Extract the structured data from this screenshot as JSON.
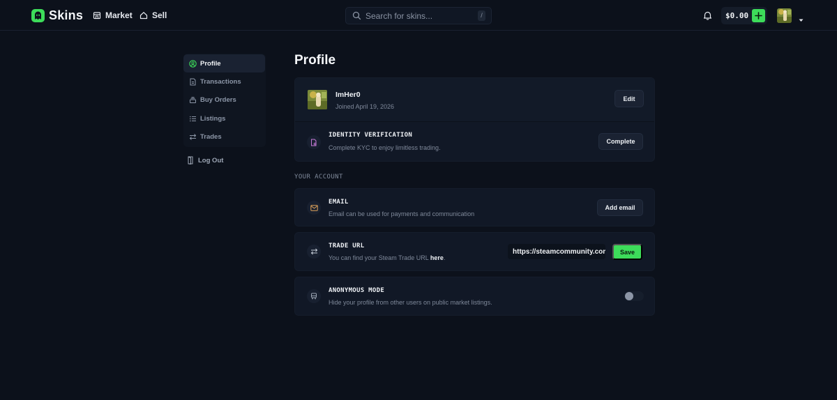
{
  "header": {
    "brand": "Skins",
    "nav": [
      {
        "label": "Market",
        "icon": "storefront-icon"
      },
      {
        "label": "Sell",
        "icon": "home-icon"
      }
    ],
    "search_placeholder": "Search for skins...",
    "search_shortcut": "/",
    "balance": "$0.00"
  },
  "sidebar": {
    "items": [
      {
        "label": "Profile",
        "icon": "user-circle-icon",
        "active": true
      },
      {
        "label": "Transactions",
        "icon": "receipt-icon"
      },
      {
        "label": "Buy Orders",
        "icon": "stack-icon"
      },
      {
        "label": "Listings",
        "icon": "list-icon"
      },
      {
        "label": "Trades",
        "icon": "swap-icon"
      }
    ],
    "logout": "Log Out"
  },
  "main": {
    "title": "Profile",
    "profile": {
      "username": "ImHer0",
      "joined": "Joined April 19, 2026",
      "edit_label": "Edit"
    },
    "identity": {
      "title": "IDENTITY VERIFICATION",
      "desc": "Complete KYC to enjoy limitless trading.",
      "button": "Complete"
    },
    "section_label": "YOUR ACCOUNT",
    "email": {
      "title": "EMAIL",
      "desc": "Email can be used for payments and communication",
      "button": "Add email"
    },
    "trade_url": {
      "title": "TRADE URL",
      "desc_prefix": "You can find your Steam Trade URL ",
      "desc_link": "here",
      "desc_suffix": ".",
      "value": "https://steamcommunity.com",
      "button": "Save"
    },
    "anonymous": {
      "title": "ANONYMOUS MODE",
      "desc": "Hide your profile from other users on public market listings.",
      "enabled": false
    }
  },
  "colors": {
    "accent": "#3ddc5a",
    "background": "#0c111b",
    "card": "#111826"
  }
}
